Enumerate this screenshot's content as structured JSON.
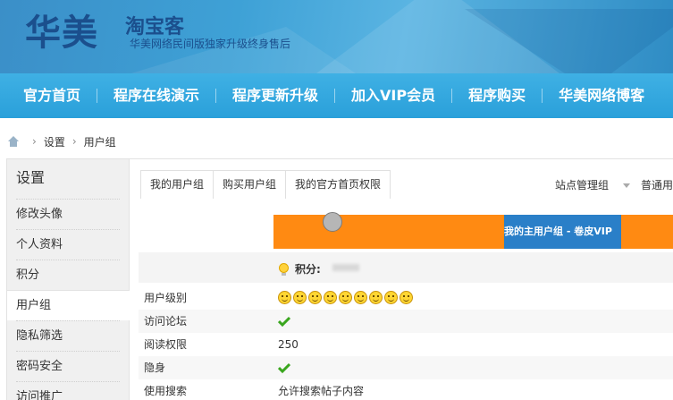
{
  "header": {
    "logo_main": "华美",
    "logo_sub": "淘宝客",
    "logo_tagline": "华美网络民间版独家升级终身售后"
  },
  "nav": {
    "items": [
      "官方首页",
      "程序在线演示",
      "程序更新升级",
      "加入VIP会员",
      "程序购买",
      "华美网络博客"
    ]
  },
  "breadcrumb": {
    "items": [
      "设置",
      "用户组"
    ]
  },
  "sidebar": {
    "title": "设置",
    "items": [
      "修改头像",
      "个人资料",
      "积分",
      "用户组",
      "隐私筛选",
      "密码安全",
      "访问推广"
    ],
    "active_index": 3
  },
  "main": {
    "tabs": [
      "我的用户组",
      "购买用户组",
      "我的官方首页权限"
    ],
    "active_tab": 0,
    "right_links": [
      "站点管理组",
      "普通用"
    ],
    "progress": {
      "label": "我的主用户组 - 卷皮VIP"
    },
    "score_label": "积分: ",
    "rows": [
      {
        "label": "用户级别",
        "value": ""
      },
      {
        "label": "访问论坛",
        "value": ""
      },
      {
        "label": "阅读权限",
        "value": "250"
      },
      {
        "label": "隐身",
        "value": ""
      },
      {
        "label": "使用搜索",
        "value": "允许搜索帖子内容"
      }
    ],
    "user_level_stars": 9
  },
  "colors": {
    "nav_bg": "#2aa0da",
    "logo": "#1b4f8d",
    "progress_orange": "#ff8a12",
    "progress_blue": "#2a7fc8",
    "check_green": "#3aa61e"
  }
}
